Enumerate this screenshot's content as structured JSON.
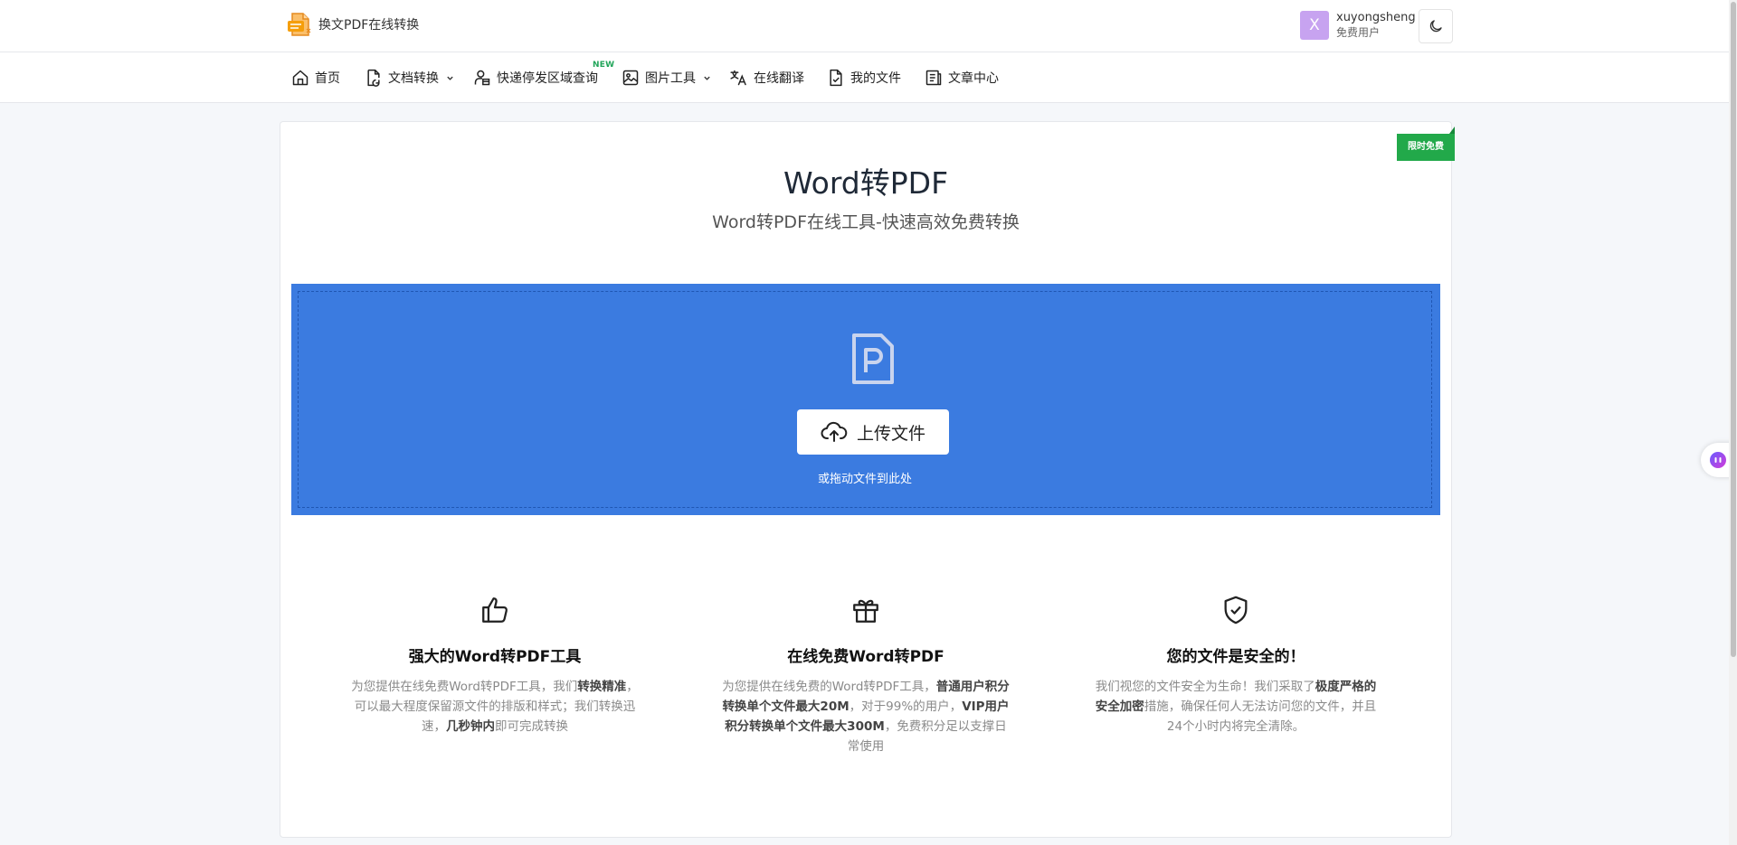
{
  "header": {
    "brand_name": "换文PDF在线转换",
    "user": {
      "avatar_letter": "X",
      "name": "xuyongsheng",
      "type": "免费用户",
      "avatar_color": "#c7a3f0"
    },
    "theme_toggle_icon": "moon-icon"
  },
  "nav": {
    "items": [
      {
        "label": "首页",
        "icon": "home-icon",
        "dropdown": false
      },
      {
        "label": "文档转换",
        "icon": "document-convert-icon",
        "dropdown": true
      },
      {
        "label": "快递停发区域查询",
        "icon": "person-package-icon",
        "dropdown": false,
        "badge": "NEW"
      },
      {
        "label": "图片工具",
        "icon": "image-icon",
        "dropdown": true
      },
      {
        "label": "在线翻译",
        "icon": "translate-icon",
        "dropdown": false
      },
      {
        "label": "我的文件",
        "icon": "file-check-icon",
        "dropdown": false
      },
      {
        "label": "文章中心",
        "icon": "article-icon",
        "dropdown": false
      }
    ]
  },
  "main": {
    "ribbon": "限时免费",
    "title": "Word转PDF",
    "subtitle": "Word转PDF在线工具-快速高效免费转换",
    "upload": {
      "file_icon": "pdf-file-icon",
      "button_label": "上传文件",
      "button_icon": "cloud-upload-icon",
      "hint": "或拖动文件到此处",
      "bg_color": "#3b7be0"
    },
    "features": [
      {
        "icon": "thumbs-up-icon",
        "title": "强大的Word转PDF工具",
        "desc": [
          {
            "t": "为您提供在线免费Word转PDF工具，我们",
            "b": false
          },
          {
            "t": "转换精准",
            "b": true
          },
          {
            "t": "，可以最大程度保留源文件的排版和样式；我们转换迅速，",
            "b": false
          },
          {
            "t": "几秒钟内",
            "b": true
          },
          {
            "t": "即可完成转换",
            "b": false
          }
        ]
      },
      {
        "icon": "gift-icon",
        "title": "在线免费Word转PDF",
        "desc": [
          {
            "t": "为您提供在线免费的Word转PDF工具，",
            "b": false
          },
          {
            "t": "普通用户积分转换单个文件最大20M",
            "b": true
          },
          {
            "t": "，对于99%的用户，",
            "b": false
          },
          {
            "t": "VIP用户积分转换单个文件最大300M",
            "b": true
          },
          {
            "t": "，免费积分足以支撑日常使用",
            "b": false
          }
        ]
      },
      {
        "icon": "shield-check-icon",
        "title": "您的文件是安全的！",
        "desc": [
          {
            "t": "我们视您的文件安全为生命！我们采取了",
            "b": false
          },
          {
            "t": "极度严格的安全加密",
            "b": true
          },
          {
            "t": "措施，确保任何人无法访问您的文件，并且24个小时内将完全清除。",
            "b": false
          }
        ]
      }
    ]
  },
  "floating": {
    "bot_icon": "assistant-bot-icon"
  },
  "colors": {
    "accent": "#3b7be0",
    "ribbon": "#22a94a",
    "new_badge": "#22a55a"
  }
}
